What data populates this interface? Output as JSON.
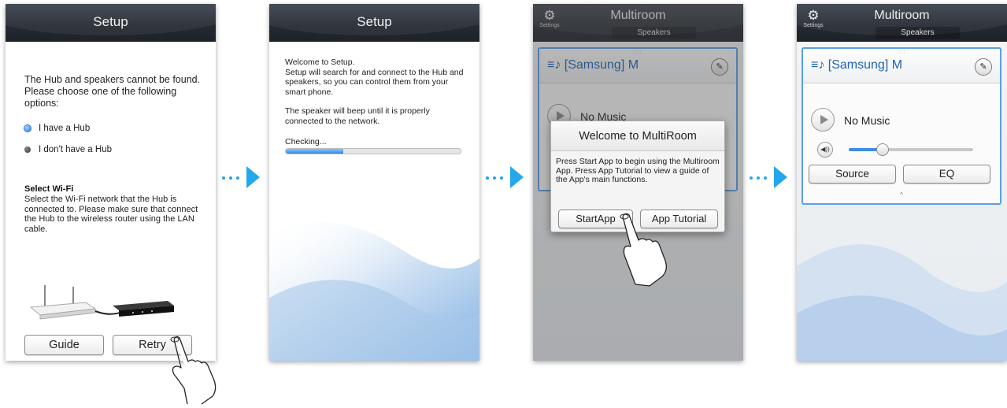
{
  "screen1": {
    "title": "Setup",
    "message": "The Hub and speakers cannot be found. Please choose one of the following options:",
    "options": [
      {
        "label": "I have a Hub",
        "selected": true
      },
      {
        "label": "I don't have a Hub",
        "selected": false
      }
    ],
    "wifi_heading": "Select Wi-Fi",
    "wifi_desc": "Select the Wi-Fi network that the Hub is connected to. Please make sure that connect the Hub to the wireless router using the LAN cable.",
    "guide_label": "Guide",
    "retry_label": "Retry"
  },
  "screen2": {
    "title": "Setup",
    "message_1": "Welcome to Setup.",
    "message_2": "Setup will search for and connect to the Hub and speakers, so you can control them from your smart phone.",
    "message_3": "The speaker will beep until it is properly connected to the network.",
    "checking_label": "Checking...",
    "progress": 0.33
  },
  "screen3": {
    "title": "Multiroom",
    "subtitle": "Speakers",
    "settings_label": "Settings",
    "speaker_name": "[Samsung] M",
    "now_playing": "No Music",
    "dialog_title": "Welcome to MultiRoom",
    "dialog_body": "Press Start App to begin using the Multiroom App. Press App Tutorial to view a guide of the App's main functions.",
    "start_label": "StartApp",
    "tutorial_label": "App Tutorial"
  },
  "screen4": {
    "title": "Multiroom",
    "subtitle": "Speakers",
    "settings_label": "Settings",
    "speaker_name": "[Samsung] M",
    "now_playing": "No Music",
    "volume": 0.27,
    "source_label": "Source",
    "eq_label": "EQ"
  },
  "colors": {
    "accent_blue": "#25a7ec",
    "selected_radio": "#2b7fd6",
    "speaker_name": "#1f63b5",
    "slider_fill": "#3f8de0"
  },
  "icons": [
    "settings-gear-icon",
    "speaker-icon",
    "edit-pencil-icon",
    "play-icon",
    "volume-icon",
    "chevron-up-icon",
    "pointing-hand-icon",
    "arrow-right-icon"
  ]
}
